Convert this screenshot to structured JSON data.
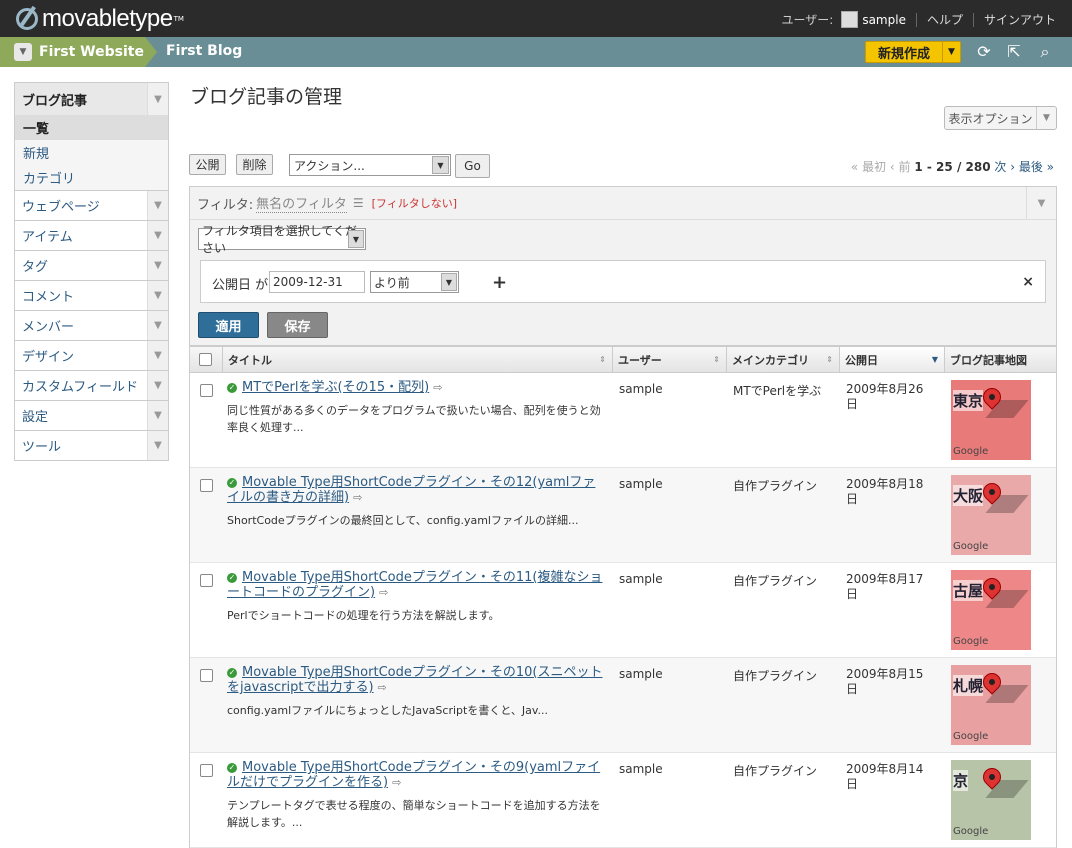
{
  "header": {
    "logo": "movabletype",
    "logo_tm": "TM",
    "user_label": "ユーザー:",
    "username": "sample",
    "help": "ヘルプ",
    "signout": "サインアウト"
  },
  "sitebar": {
    "website": "First Website",
    "blog": "First Blog",
    "new_button": "新規作成"
  },
  "sidebar": {
    "head": "ブログ記事",
    "subs": [
      {
        "label": "一覧",
        "active": true
      },
      {
        "label": "新規"
      },
      {
        "label": "カテゴリ"
      }
    ],
    "items": [
      "ウェブページ",
      "アイテム",
      "タグ",
      "コメント",
      "メンバー",
      "デザイン",
      "カスタムフィールド",
      "設定",
      "ツール"
    ]
  },
  "page": {
    "title": "ブログ記事の管理",
    "display_options": "表示オプション"
  },
  "actions": {
    "publish": "公開",
    "delete": "削除",
    "action_select": "アクション...",
    "go": "Go"
  },
  "pager": {
    "first": "« 最初",
    "prev": "‹ 前",
    "range": "1 - 25 / 280",
    "next": "次 ›",
    "last": "最後 »"
  },
  "filter": {
    "label": "フィルタ:",
    "name": "無名のフィルタ",
    "no_filter": "[フィルタしない]",
    "select": "フィルタ項目を選択してください",
    "field": "公開日 が",
    "date": "2009-12-31",
    "relation": "より前",
    "apply": "適用",
    "save": "保存"
  },
  "table": {
    "headers": [
      "タイトル",
      "ユーザー",
      "メインカテゴリ",
      "公開日",
      "ブログ記事地図"
    ],
    "rows": [
      {
        "title": "MTでPerlを学ぶ(その15・配列)",
        "excerpt": "同じ性質がある多くのデータをプログラムで扱いたい場合、配列を使うと効率良く処理す...",
        "user": "sample",
        "category": "MTでPerlを学ぶ",
        "date": "2009年8月26日",
        "map_city": "東京",
        "map_color": "#e87a7a"
      },
      {
        "title": "Movable Type用ShortCodeプラグイン・その12(yamlファイルの書き方の詳細)",
        "excerpt": "ShortCodeプラグインの最終回として、config.yamlファイルの詳細...",
        "user": "sample",
        "category": "自作プラグイン",
        "date": "2009年8月18日",
        "map_city": "大阪",
        "map_color": "#e9a9a9"
      },
      {
        "title": "Movable Type用ShortCodeプラグイン・その11(複雑なショートコードのプラグイン)",
        "excerpt": "Perlでショートコードの処理を行う方法を解説します。",
        "user": "sample",
        "category": "自作プラグイン",
        "date": "2009年8月17日",
        "map_city": "古屋",
        "map_color": "#e88"
      },
      {
        "title": "Movable Type用ShortCodeプラグイン・その10(スニペットをjavascriptで出力する)",
        "excerpt": "config.yamlファイルにちょっとしたJavaScriptを書くと、Jav...",
        "user": "sample",
        "category": "自作プラグイン",
        "date": "2009年8月15日",
        "map_city": "札幌",
        "map_color": "#e9a0a0"
      },
      {
        "title": "Movable Type用ShortCodeプラグイン・その9(yamlファイルだけでプラグインを作る)",
        "excerpt": "テンプレートタグで表せる程度の、簡単なショートコードを追加する方法を解説します。...",
        "user": "sample",
        "category": "自作プラグイン",
        "date": "2009年8月14日",
        "map_city": "京",
        "map_color": "#b8c4a8"
      }
    ]
  },
  "map_google": "Google"
}
